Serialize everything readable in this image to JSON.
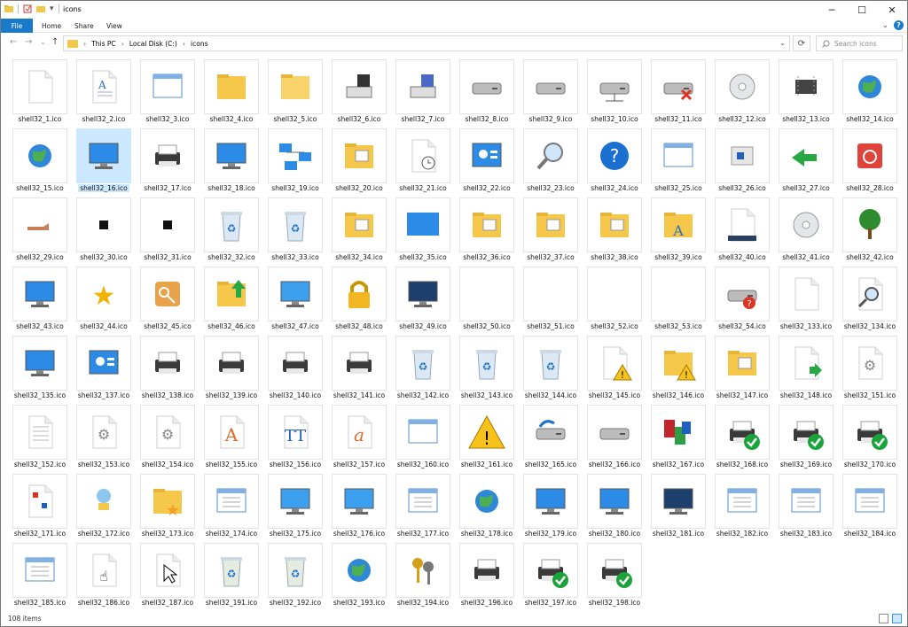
{
  "window": {
    "title": "icons",
    "controls": {
      "minimize": "─",
      "maximize": "☐",
      "close": "✕"
    }
  },
  "ribbon": {
    "tabs": [
      "File",
      "Home",
      "Share",
      "View"
    ],
    "help": "?"
  },
  "address": {
    "crumbs": [
      "This PC",
      "Local Disk (C:)",
      "icons"
    ],
    "search_placeholder": "Search icons"
  },
  "status": {
    "items_count": "108 items"
  },
  "files": [
    {
      "name": "shell32_1.ico",
      "icon": "blank-document",
      "selected": false
    },
    {
      "name": "shell32_2.ico",
      "icon": "text-document"
    },
    {
      "name": "shell32_3.ico",
      "icon": "application-window"
    },
    {
      "name": "shell32_4.ico",
      "icon": "folder"
    },
    {
      "name": "shell32_5.ico",
      "icon": "folder-open"
    },
    {
      "name": "shell32_6.ico",
      "icon": "floppy-drive"
    },
    {
      "name": "shell32_7.ico",
      "icon": "floppy-drive-blue"
    },
    {
      "name": "shell32_8.ico",
      "icon": "removable-drive"
    },
    {
      "name": "shell32_9.ico",
      "icon": "hard-drive"
    },
    {
      "name": "shell32_10.ico",
      "icon": "network-drive"
    },
    {
      "name": "shell32_11.ico",
      "icon": "network-drive-disconnected"
    },
    {
      "name": "shell32_12.ico",
      "icon": "cd-drive"
    },
    {
      "name": "shell32_13.ico",
      "icon": "chip"
    },
    {
      "name": "shell32_14.ico",
      "icon": "internet-globe"
    },
    {
      "name": "shell32_15.ico",
      "icon": "network-globe"
    },
    {
      "name": "shell32_16.ico",
      "icon": "computer",
      "selected": true
    },
    {
      "name": "shell32_17.ico",
      "icon": "printer"
    },
    {
      "name": "shell32_18.ico",
      "icon": "network-computer"
    },
    {
      "name": "shell32_19.ico",
      "icon": "network"
    },
    {
      "name": "shell32_20.ico",
      "icon": "folder-pictures"
    },
    {
      "name": "shell32_21.ico",
      "icon": "recent-document"
    },
    {
      "name": "shell32_22.ico",
      "icon": "control-panel"
    },
    {
      "name": "shell32_23.ico",
      "icon": "search"
    },
    {
      "name": "shell32_24.ico",
      "icon": "help"
    },
    {
      "name": "shell32_25.ico",
      "icon": "run-window"
    },
    {
      "name": "shell32_26.ico",
      "icon": "sleep"
    },
    {
      "name": "shell32_27.ico",
      "icon": "undock"
    },
    {
      "name": "shell32_28.ico",
      "icon": "shutdown"
    },
    {
      "name": "shell32_29.ico",
      "icon": "shared-hand"
    },
    {
      "name": "shell32_30.ico",
      "icon": "shortcut-arrow"
    },
    {
      "name": "shell32_31.ico",
      "icon": "small-overlay"
    },
    {
      "name": "shell32_32.ico",
      "icon": "recycle-bin-empty"
    },
    {
      "name": "shell32_33.ico",
      "icon": "recycle-bin-full"
    },
    {
      "name": "shell32_34.ico",
      "icon": "folder-network"
    },
    {
      "name": "shell32_35.ico",
      "icon": "desktop"
    },
    {
      "name": "shell32_36.ico",
      "icon": "folder-tools"
    },
    {
      "name": "shell32_37.ico",
      "icon": "folder-pictures-large"
    },
    {
      "name": "shell32_38.ico",
      "icon": "folder-printer"
    },
    {
      "name": "shell32_39.ico",
      "icon": "folder-fonts"
    },
    {
      "name": "shell32_40.ico",
      "icon": "taskbar-settings"
    },
    {
      "name": "shell32_41.ico",
      "icon": "cd-audio"
    },
    {
      "name": "shell32_42.ico",
      "icon": "tree"
    },
    {
      "name": "shell32_43.ico",
      "icon": "computer-folder"
    },
    {
      "name": "shell32_44.ico",
      "icon": "favorites-star"
    },
    {
      "name": "shell32_45.ico",
      "icon": "logoff-key"
    },
    {
      "name": "shell32_46.ico",
      "icon": "folder-upload"
    },
    {
      "name": "shell32_47.ico",
      "icon": "sync-screen"
    },
    {
      "name": "shell32_48.ico",
      "icon": "lock"
    },
    {
      "name": "shell32_49.ico",
      "icon": "display-settings"
    },
    {
      "name": "shell32_50.ico",
      "icon": "empty"
    },
    {
      "name": "shell32_51.ico",
      "icon": "empty"
    },
    {
      "name": "shell32_52.ico",
      "icon": "empty"
    },
    {
      "name": "shell32_53.ico",
      "icon": "empty"
    },
    {
      "name": "shell32_54.ico",
      "icon": "drive-question"
    },
    {
      "name": "shell32_133.ico",
      "icon": "multiple-documents"
    },
    {
      "name": "shell32_134.ico",
      "icon": "search-document"
    },
    {
      "name": "shell32_135.ico",
      "icon": "search-computer"
    },
    {
      "name": "shell32_137.ico",
      "icon": "control-panel-blue"
    },
    {
      "name": "shell32_138.ico",
      "icon": "printer-folder"
    },
    {
      "name": "shell32_139.ico",
      "icon": "printer-add"
    },
    {
      "name": "shell32_140.ico",
      "icon": "printer-network"
    },
    {
      "name": "shell32_141.ico",
      "icon": "printer-file"
    },
    {
      "name": "shell32_142.ico",
      "icon": "recycle-bin-full"
    },
    {
      "name": "shell32_143.ico",
      "icon": "recycle-bin-full"
    },
    {
      "name": "shell32_144.ico",
      "icon": "recycle-bin-full"
    },
    {
      "name": "shell32_145.ico",
      "icon": "document-warning"
    },
    {
      "name": "shell32_146.ico",
      "icon": "folder-warning"
    },
    {
      "name": "shell32_147.ico",
      "icon": "folder-doc"
    },
    {
      "name": "shell32_148.ico",
      "icon": "move-documents"
    },
    {
      "name": "shell32_151.ico",
      "icon": "settings-document"
    },
    {
      "name": "shell32_152.ico",
      "icon": "lined-document"
    },
    {
      "name": "shell32_153.ico",
      "icon": "settings-window"
    },
    {
      "name": "shell32_154.ico",
      "icon": "settings-file"
    },
    {
      "name": "shell32_155.ico",
      "icon": "font-a"
    },
    {
      "name": "shell32_156.ico",
      "icon": "font-tt"
    },
    {
      "name": "shell32_157.ico",
      "icon": "font-o"
    },
    {
      "name": "shell32_160.ico",
      "icon": "run-window-large"
    },
    {
      "name": "shell32_161.ico",
      "icon": "warning"
    },
    {
      "name": "shell32_165.ico",
      "icon": "drive-backup"
    },
    {
      "name": "shell32_166.ico",
      "icon": "drive-plain"
    },
    {
      "name": "shell32_167.ico",
      "icon": "blocks"
    },
    {
      "name": "shell32_168.ico",
      "icon": "printer-check"
    },
    {
      "name": "shell32_169.ico",
      "icon": "printer-check-small"
    },
    {
      "name": "shell32_170.ico",
      "icon": "printer-floppy-check"
    },
    {
      "name": "shell32_171.ico",
      "icon": "flowchart"
    },
    {
      "name": "shell32_172.ico",
      "icon": "network-pin"
    },
    {
      "name": "shell32_173.ico",
      "icon": "folder-star"
    },
    {
      "name": "shell32_174.ico",
      "icon": "checklist-window"
    },
    {
      "name": "shell32_175.ico",
      "icon": "folder-screens"
    },
    {
      "name": "shell32_176.ico",
      "icon": "dual-screens"
    },
    {
      "name": "shell32_177.ico",
      "icon": "window-tools"
    },
    {
      "name": "shell32_178.ico",
      "icon": "globe-frame"
    },
    {
      "name": "shell32_179.ico",
      "icon": "computer-globe"
    },
    {
      "name": "shell32_180.ico",
      "icon": "monitor"
    },
    {
      "name": "shell32_181.ico",
      "icon": "monitor-dark"
    },
    {
      "name": "shell32_182.ico",
      "icon": "window-list"
    },
    {
      "name": "shell32_183.ico",
      "icon": "window-icons"
    },
    {
      "name": "shell32_184.ico",
      "icon": "window-image"
    },
    {
      "name": "shell32_185.ico",
      "icon": "window-cascade"
    },
    {
      "name": "shell32_186.ico",
      "icon": "hand-cursor"
    },
    {
      "name": "shell32_187.ico",
      "icon": "arrow-cursor"
    },
    {
      "name": "shell32_191.ico",
      "icon": "recycle-bin-green"
    },
    {
      "name": "shell32_192.ico",
      "icon": "recycle-bin-green-full"
    },
    {
      "name": "shell32_193.ico",
      "icon": "globe-folder"
    },
    {
      "name": "shell32_194.ico",
      "icon": "keys"
    },
    {
      "name": "shell32_196.ico",
      "icon": "fax"
    },
    {
      "name": "shell32_197.ico",
      "icon": "fax-check"
    },
    {
      "name": "shell32_198.ico",
      "icon": "fax-check-alt"
    }
  ]
}
